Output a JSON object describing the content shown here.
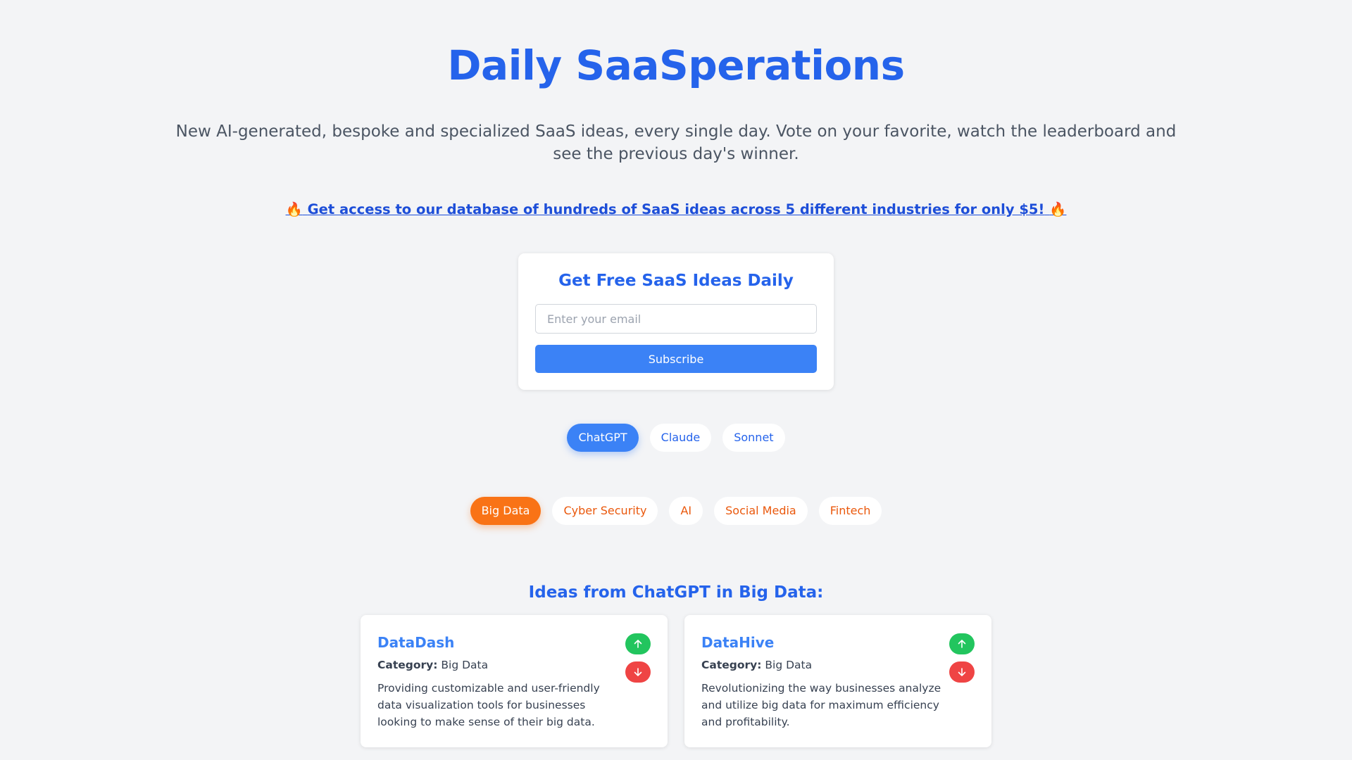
{
  "header": {
    "title": "Daily SaaSperations",
    "subtitle": "New AI-generated, bespoke and specialized SaaS ideas, every single day. Vote on your favorite, watch the leaderboard and see the previous day's winner."
  },
  "promo": {
    "icon_left": "🔥",
    "text": "Get access to our database of hundreds of SaaS ideas across 5 different industries for only $5!",
    "icon_right": "🔥"
  },
  "subscribe": {
    "heading": "Get Free SaaS Ideas Daily",
    "email_placeholder": "Enter your email",
    "email_value": "",
    "button_label": "Subscribe"
  },
  "models": {
    "selected": "ChatGPT",
    "items": [
      "ChatGPT",
      "Claude",
      "Sonnet"
    ]
  },
  "categories": {
    "selected": "Big Data",
    "items": [
      "Big Data",
      "Cyber Security",
      "AI",
      "Social Media",
      "Fintech"
    ]
  },
  "ideas_section": {
    "title": "Ideas from ChatGPT in Big Data:",
    "category_label": "Category:",
    "ideas": [
      {
        "name": "DataDash",
        "category": "Big Data",
        "description": "Providing customizable and user-friendly data visualization tools for businesses looking to make sense of their big data."
      },
      {
        "name": "DataHive",
        "category": "Big Data",
        "description": "Revolutionizing the way businesses analyze and utilize big data for maximum efficiency and profitability."
      }
    ]
  },
  "icons": {
    "upvote": "arrow-up-icon",
    "downvote": "arrow-down-icon",
    "promo": "fire-emoji"
  },
  "colors": {
    "accent_blue": "#2563eb",
    "button_blue": "#3b82f6",
    "accent_orange": "#f97316",
    "upvote_green": "#22c55e",
    "downvote_red": "#ef4444",
    "background": "#f3f4f6"
  }
}
